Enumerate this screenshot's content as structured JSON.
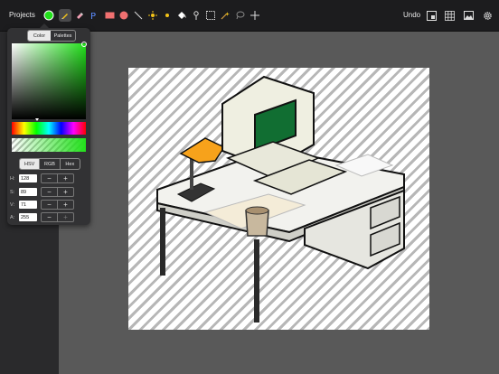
{
  "toolbar": {
    "projects_label": "Projects",
    "undo_label": "Undo",
    "current_color": "#22e01b",
    "tools": [
      {
        "name": "pencil-icon",
        "active": true
      },
      {
        "name": "eraser-icon"
      },
      {
        "name": "pen-icon"
      },
      {
        "name": "rectangle-icon"
      },
      {
        "name": "circle-icon"
      },
      {
        "name": "line-icon"
      },
      {
        "name": "brightness-icon"
      },
      {
        "name": "dither-icon"
      },
      {
        "name": "fill-bucket-icon"
      },
      {
        "name": "eyedropper-icon"
      },
      {
        "name": "selection-icon"
      },
      {
        "name": "magic-wand-icon"
      },
      {
        "name": "lasso-icon"
      },
      {
        "name": "move-icon"
      }
    ],
    "right_icons": [
      "layers-icon",
      "grid-icon",
      "image-icon",
      "settings-icon"
    ]
  },
  "color_panel": {
    "tabs": [
      "Color",
      "Palettes"
    ],
    "selected_tab": "Color",
    "modes": [
      "HSV",
      "RGB",
      "Hex"
    ],
    "selected_mode": "HSV",
    "hue_color": "#22e01b",
    "channels": [
      {
        "label": "H:",
        "value": "128"
      },
      {
        "label": "S:",
        "value": "89"
      },
      {
        "label": "V:",
        "value": "71"
      },
      {
        "label": "A:",
        "value": "255"
      }
    ],
    "minus": "−",
    "plus": "+"
  }
}
